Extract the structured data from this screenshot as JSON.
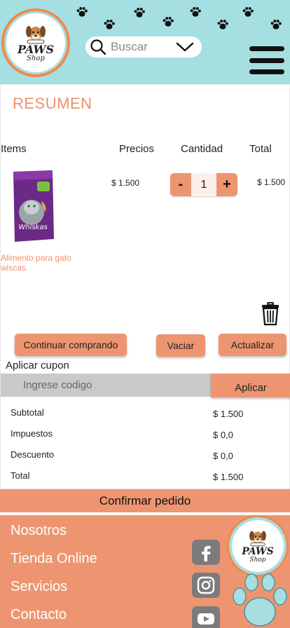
{
  "brand": {
    "title": "PAWS",
    "subtitle": "Shop"
  },
  "header": {
    "search_placeholder": "Buscar",
    "search_icon": "search-icon",
    "dropdown_icon": "chevron-down-icon",
    "menu_icon": "hamburger-menu-icon"
  },
  "colors": {
    "header_bg": "#a6dfe2",
    "accent": "#ed9571",
    "title": "#f0906a",
    "input_bg": "#c9c9c9",
    "social_bg": "#7b7b7b"
  },
  "summary": {
    "title": "RESUMEN",
    "columns": {
      "items": "Items",
      "prices": "Precios",
      "quantity": "Cantidad",
      "total": "Total"
    },
    "item": {
      "name": "Alimento para gato wiscas",
      "brand_label": "Whiskas",
      "price": "$ 1.500",
      "quantity": "1",
      "total": "$ 1.500",
      "minus": "-",
      "plus": "+"
    },
    "trash_icon": "trash-icon"
  },
  "actions": {
    "continue": "Continuar comprando",
    "empty": "Vaciar",
    "update": "Actualizar"
  },
  "coupon": {
    "label": "Aplicar cupon",
    "placeholder": "Ingrese codigo",
    "apply": "Aplicar"
  },
  "totals": {
    "subtotal_label": "Subtotal",
    "subtotal": "$ 1.500",
    "tax_label": "Impuestos",
    "tax": "$ 0,0",
    "discount_label": "Descuento",
    "discount": "$ 0,0",
    "total_label": "Total",
    "total": "$ 1.500"
  },
  "confirm": "Confirmar pedido",
  "footer": {
    "links": [
      "Nosotros",
      "Tienda Online",
      "Servicios",
      "Contacto"
    ],
    "social_icons": [
      "facebook-icon",
      "instagram-icon",
      "youtube-icon"
    ]
  }
}
